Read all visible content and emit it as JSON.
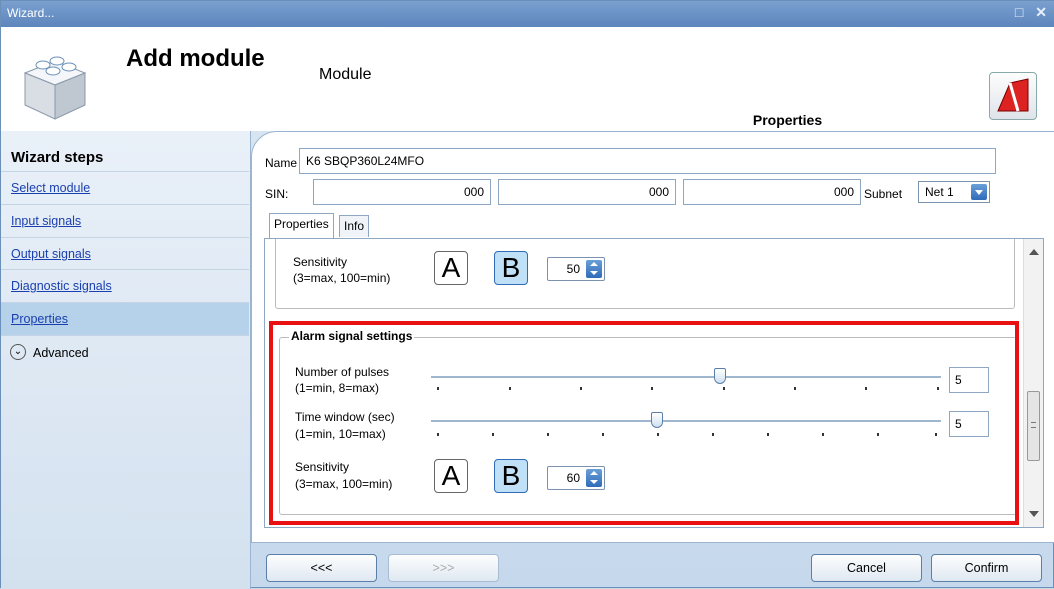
{
  "window": {
    "title": "Wizard...",
    "controls": "□ ✕"
  },
  "header": {
    "title": "Add module",
    "subtitle": "Module",
    "section_tab": "Properties"
  },
  "sidebar": {
    "title": "Wizard steps",
    "items": [
      {
        "label": "Select module"
      },
      {
        "label": "Input signals"
      },
      {
        "label": "Output signals"
      },
      {
        "label": "Diagnostic signals"
      },
      {
        "label": "Properties"
      }
    ],
    "advanced_label": "Advanced"
  },
  "form": {
    "name_label": "Name",
    "name_value": "K6 SBQP360L24MFO",
    "sin_label": "SIN:",
    "sin_values": [
      "000",
      "000",
      "000"
    ],
    "subnet_label": "Subnet",
    "subnet_value": "Net 1"
  },
  "tabs": [
    {
      "label": "Properties"
    },
    {
      "label": "Info"
    }
  ],
  "sensitivity_top": {
    "label_line1": "Sensitivity",
    "label_line2": "(3=max, 100=min)",
    "btn_a": "A",
    "btn_b": "B",
    "value": "50"
  },
  "alarm": {
    "title": "Alarm signal settings",
    "pulses": {
      "label_line1": "Number of pulses",
      "label_line2": "(1=min, 8=max)",
      "value": "5"
    },
    "window": {
      "label_line1": "Time window (sec)",
      "label_line2": "(1=min, 10=max)",
      "value": "5"
    },
    "sensitivity": {
      "label_line1": "Sensitivity",
      "label_line2": "(3=max, 100=min)",
      "btn_a": "A",
      "btn_b": "B",
      "value": "60"
    }
  },
  "buttons": {
    "back": "<<<",
    "next": ">>>",
    "cancel": "Cancel",
    "confirm": "Confirm"
  }
}
